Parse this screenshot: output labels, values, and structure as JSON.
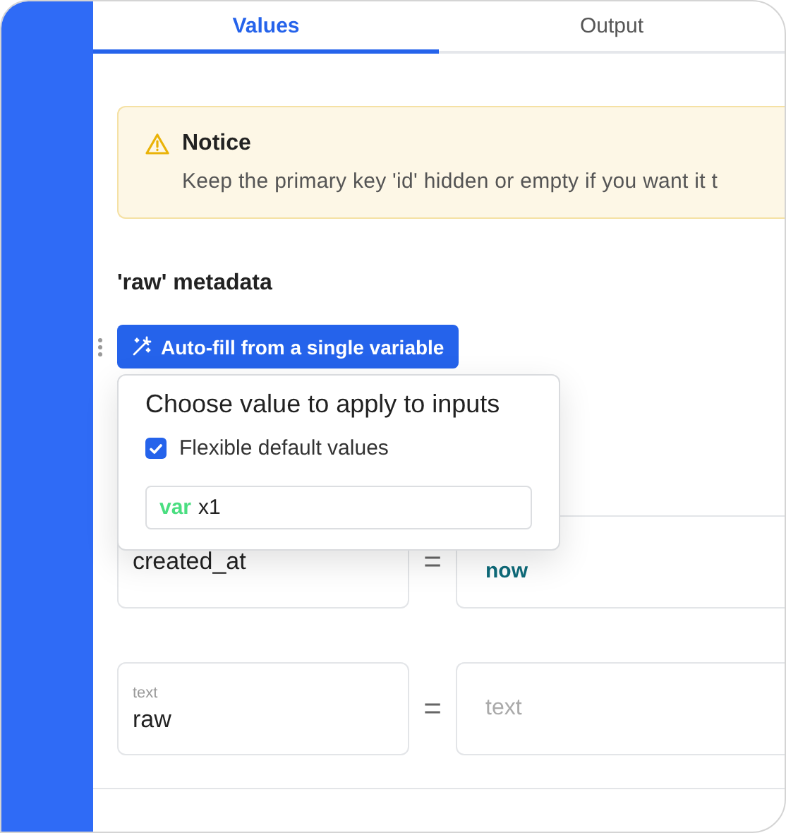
{
  "tabs": [
    {
      "label": "Values",
      "selected": true
    },
    {
      "label": "Output",
      "selected": false
    }
  ],
  "notice": {
    "title": "Notice",
    "message": "Keep the primary key 'id' hidden or empty if you want it t"
  },
  "section_title": "'raw' metadata",
  "autofill_button": {
    "label": "Auto-fill from a single variable"
  },
  "popover": {
    "title": "Choose value to apply to inputs",
    "checkbox": {
      "label": "Flexible default values",
      "checked": true
    },
    "input": {
      "keyword": "var",
      "value": "x1"
    }
  },
  "fields": [
    {
      "kind": "expression",
      "name": "created_at",
      "operator": "=",
      "value": "now"
    },
    {
      "kind": "typed",
      "type_label": "text",
      "name": "raw",
      "operator": "=",
      "placeholder": "text"
    }
  ]
}
